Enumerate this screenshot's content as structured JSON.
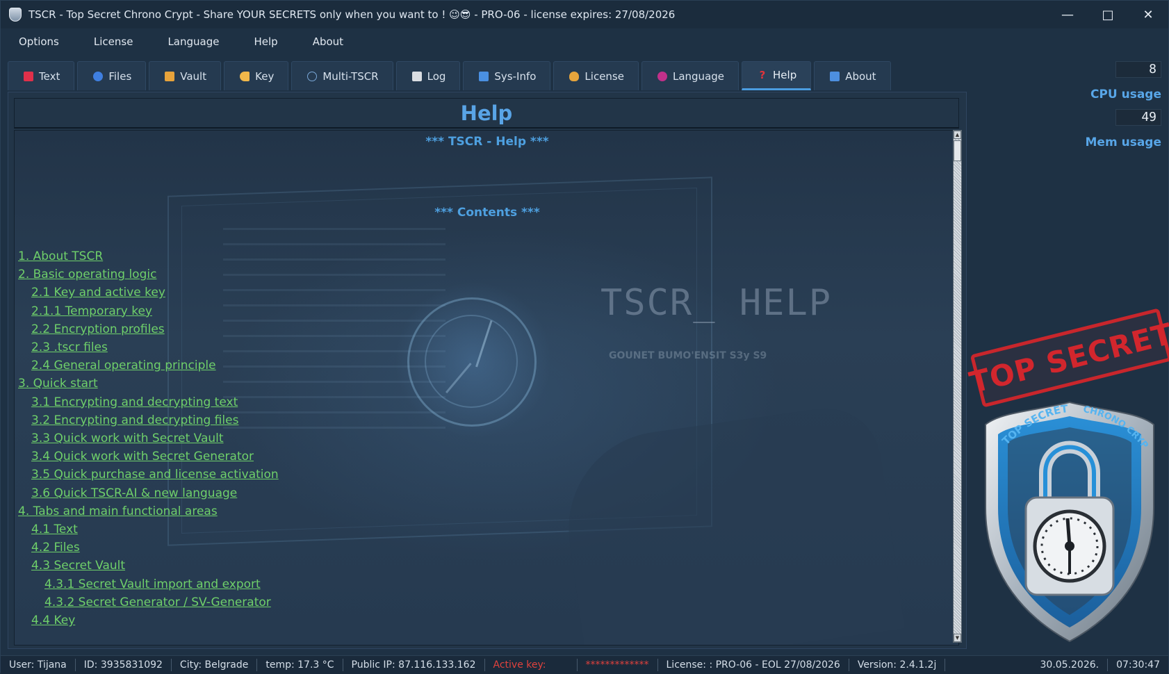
{
  "window": {
    "title": "TSCR - Top Secret Chrono Crypt - Share YOUR SECRETS only when you want to ! 😉😎 - PRO-06 - license expires: 27/08/2026",
    "controls": {
      "minimize": "—",
      "maximize": "□",
      "close": "✕"
    }
  },
  "menu": [
    "Options",
    "License",
    "Language",
    "Help",
    "About"
  ],
  "tabs": [
    {
      "label": "Text",
      "icon": "text-icon",
      "color": "#e0304a"
    },
    {
      "label": "Files",
      "icon": "globe-icon",
      "color": "#3f7fe0"
    },
    {
      "label": "Vault",
      "icon": "vault-icon",
      "color": "#e7a33b"
    },
    {
      "label": "Key",
      "icon": "key-icon",
      "color": "#f2b84a"
    },
    {
      "label": "Multi-TSCR",
      "icon": "m-circle-icon",
      "color": "#7aa8d8"
    },
    {
      "label": "Log",
      "icon": "document-icon",
      "color": "#d9dde2"
    },
    {
      "label": "Sys-Info",
      "icon": "bar-chart-icon",
      "color": "#4a90e2"
    },
    {
      "label": "License",
      "icon": "money-bag-icon",
      "color": "#e6a43c"
    },
    {
      "label": "Language",
      "icon": "language-icon",
      "color": "#c2308a"
    },
    {
      "label": "Help",
      "icon": "question-icon",
      "color": "#e2333b",
      "active": true
    },
    {
      "label": "About",
      "icon": "info-icon",
      "color": "#4d8fe0"
    }
  ],
  "help": {
    "title": "Help",
    "heading": "*** TSCR - Help ***",
    "contents_heading": "*** Contents ***",
    "background_label": "TSCR_ HELP",
    "background_sub": "GOUNET BUMO'ENSIT S3y S9",
    "toc": [
      {
        "text": "1. About TSCR",
        "level": 1
      },
      {
        "text": "2. Basic operating logic",
        "level": 1
      },
      {
        "text": "2.1 Key and active key",
        "level": 2
      },
      {
        "text": "2.1.1 Temporary key",
        "level": 2
      },
      {
        "text": "2.2 Encryption profiles",
        "level": 2
      },
      {
        "text": "2.3 .tscr files",
        "level": 2
      },
      {
        "text": "2.4 General operating principle",
        "level": 2
      },
      {
        "text": "3. Quick start",
        "level": 1
      },
      {
        "text": "3.1 Encrypting and decrypting text",
        "level": 2
      },
      {
        "text": "3.2 Encrypting and decrypting files",
        "level": 2
      },
      {
        "text": "3.3 Quick work with Secret Vault",
        "level": 2
      },
      {
        "text": "3.4 Quick work with Secret Generator",
        "level": 2
      },
      {
        "text": "3.5 Quick purchase and license activation",
        "level": 2
      },
      {
        "text": "3.6 Quick TSCR-AI & new language",
        "level": 2
      },
      {
        "text": "4. Tabs and main functional areas",
        "level": 1
      },
      {
        "text": "4.1 Text",
        "level": 2
      },
      {
        "text": "4.2 Files",
        "level": 2
      },
      {
        "text": "4.3 Secret Vault",
        "level": 2
      },
      {
        "text": "4.3.1 Secret Vault import and export",
        "level": 3
      },
      {
        "text": "4.3.2 Secret Generator / SV-Generator",
        "level": 3
      },
      {
        "text": "4.4 Key",
        "level": 2
      }
    ]
  },
  "meters": {
    "cpu_value": "8",
    "cpu_label": "CPU usage",
    "mem_value": "49",
    "mem_label": "Mem usage"
  },
  "branding": {
    "stamp": "TOP SECRET",
    "shield_text_left": "TOP SECRET",
    "shield_text_right": "CHRONO CRYPT"
  },
  "status": {
    "user": "User: Tijana",
    "id": "ID: 3935831092",
    "city": "City: Belgrade",
    "temp": "temp: 17.3 °C",
    "ip": "Public IP: 87.116.133.162",
    "active_key_label": "Active key:",
    "active_key_value": "*************",
    "license": "License: : PRO-06 - EOL 27/08/2026",
    "version": "Version: 2.4.1.2j",
    "date": "30.05.2026.",
    "time": "07:30:47"
  },
  "colors": {
    "accent": "#4b9de0",
    "link": "#6fd06a",
    "heading": "#4ea0e0",
    "stamp": "#d2262d"
  }
}
